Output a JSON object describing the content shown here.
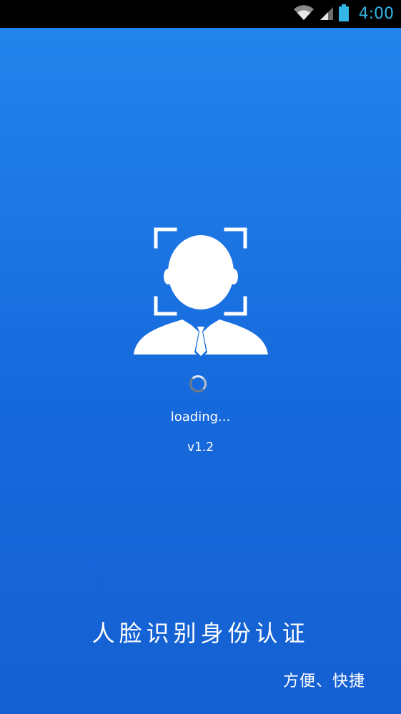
{
  "status_bar": {
    "time": "4:00",
    "icons": [
      "wifi-icon",
      "cellular-signal-icon",
      "battery-icon"
    ],
    "time_color": "#33b5e5"
  },
  "splash": {
    "logo_icon": "face-recognition-avatar-icon",
    "loading_text": "loading...",
    "version": "v1.2",
    "title": "人脸识别身份认证",
    "subtitle": "方便、快捷",
    "background_colors": [
      "#2384ec",
      "#1560d2"
    ]
  }
}
